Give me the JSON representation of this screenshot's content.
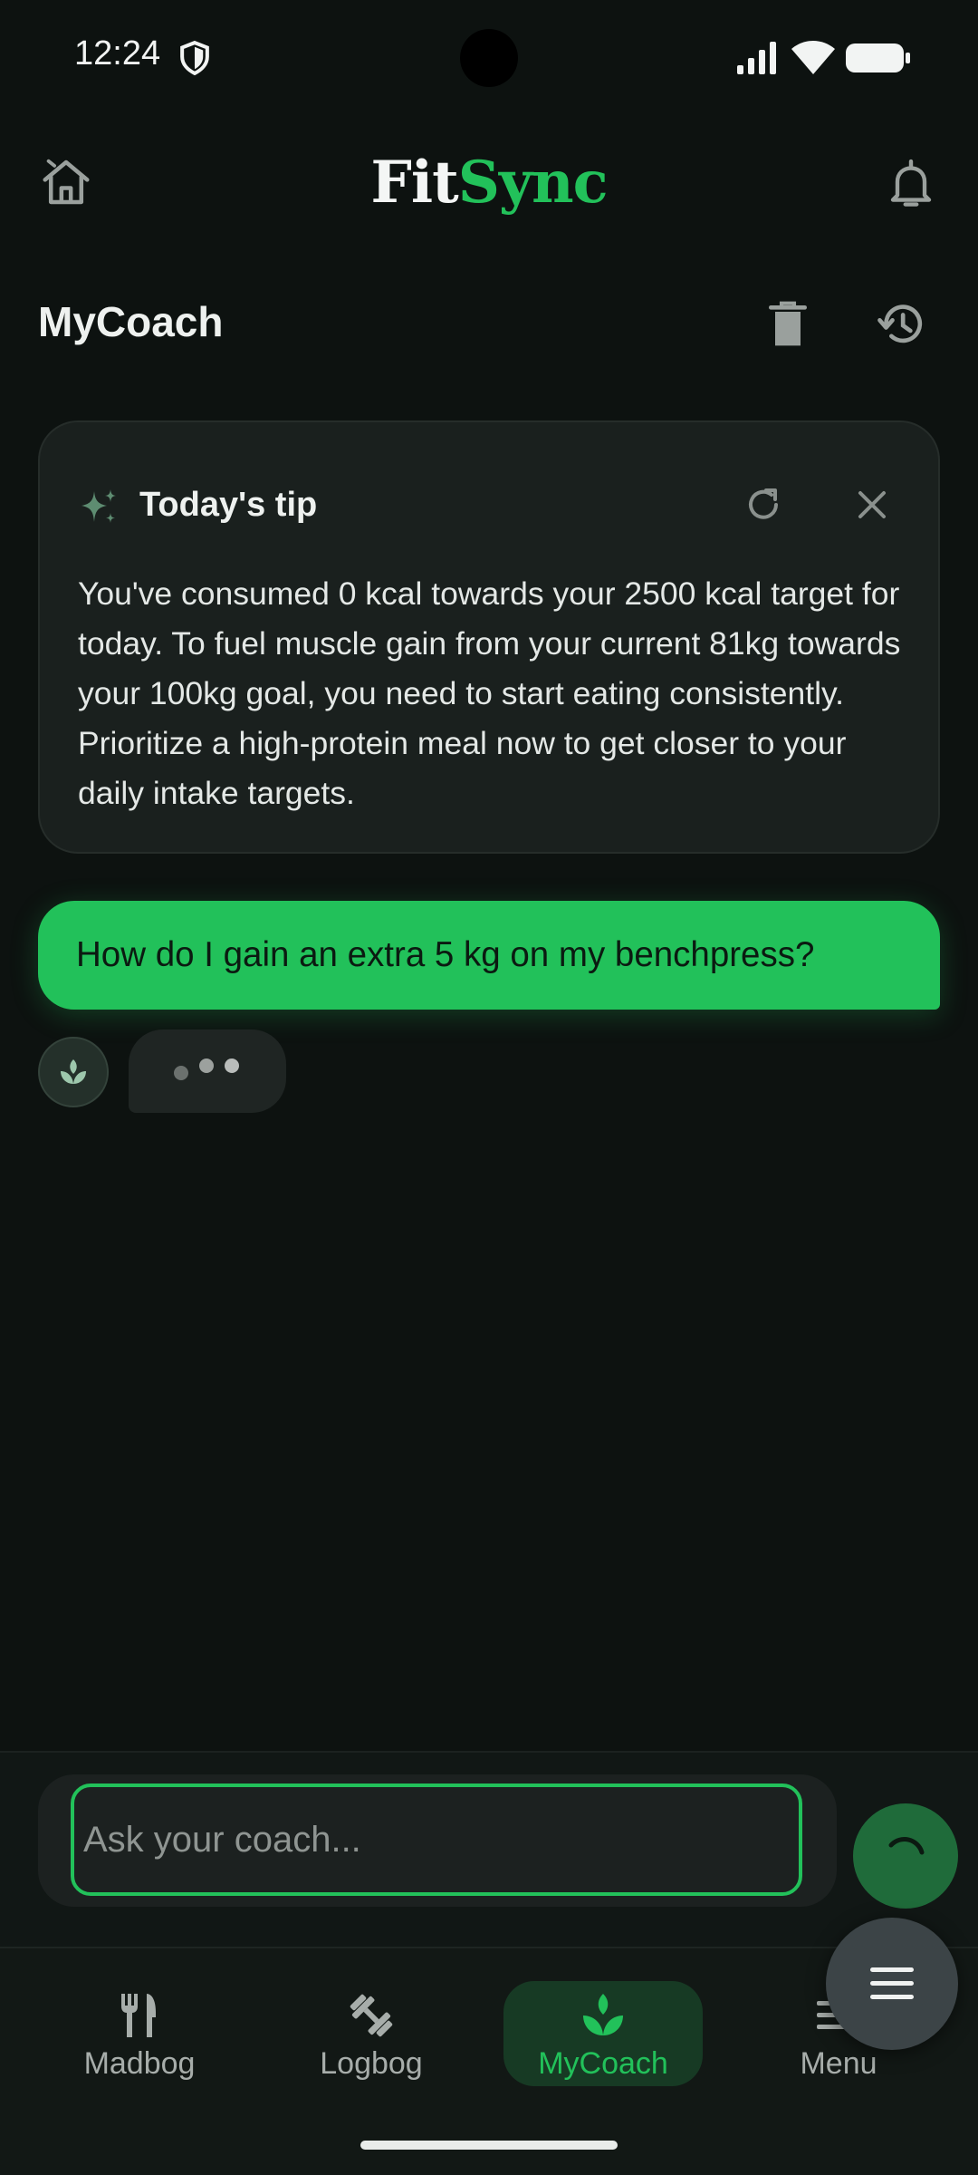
{
  "status_bar": {
    "time": "12:24",
    "icons": [
      "shield-icon",
      "signal-icon",
      "wifi-icon",
      "battery-icon"
    ]
  },
  "header": {
    "title_part1": "Fit",
    "title_part2": "Sync",
    "left_icon": "home-icon",
    "right_icon": "bell-icon"
  },
  "page": {
    "title": "MyCoach",
    "actions": [
      "trash-icon",
      "history-icon"
    ]
  },
  "tip_card": {
    "title": "Today's tip",
    "body": "You've consumed 0 kcal towards your 2500 kcal target for today. To fuel muscle gain from your current 81kg towards your 100kg goal, you need to start eating consistently. Prioritize a high-protein meal now to get closer to your daily intake targets.",
    "icons": [
      "sparkle-icon",
      "refresh-icon",
      "close-icon"
    ]
  },
  "chat": {
    "messages": [
      {
        "role": "user",
        "text": "How do I gain an extra 5 kg on my benchpress?"
      }
    ],
    "coach_typing": true
  },
  "input": {
    "placeholder": "Ask your coach...",
    "value": ""
  },
  "bottom_nav": {
    "items": [
      {
        "label": "Madbog",
        "icon": "fork-knife-icon",
        "active": false
      },
      {
        "label": "Logbog",
        "icon": "dumbbell-icon",
        "active": false
      },
      {
        "label": "MyCoach",
        "icon": "sprout-icon",
        "active": true
      },
      {
        "label": "Menu",
        "icon": "menu-icon",
        "active": false
      }
    ]
  },
  "colors": {
    "background": "#0d1210",
    "accent": "#22c15a",
    "card": "#1a201e",
    "text": "#e9ecea"
  }
}
